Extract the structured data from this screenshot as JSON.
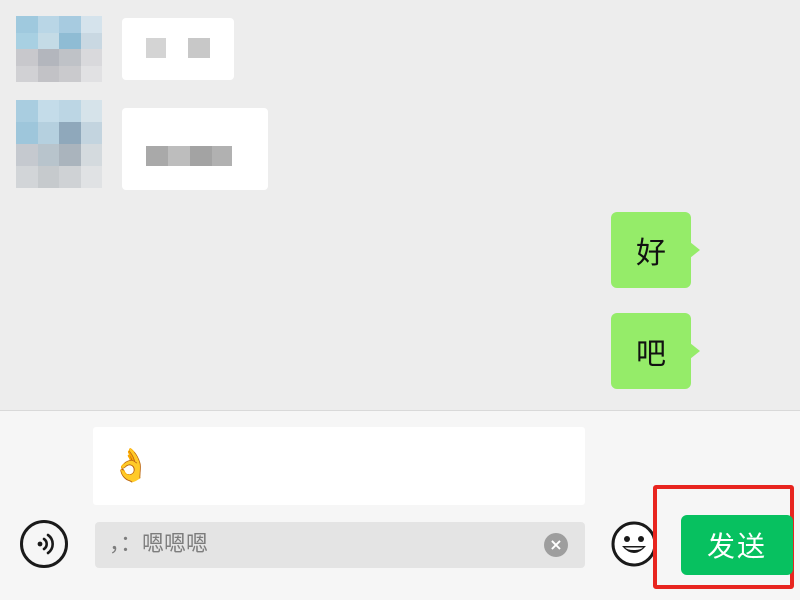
{
  "conversation": {
    "incoming_messages": [
      {
        "sender": "contact",
        "content": "[blurred]"
      },
      {
        "sender": "contact",
        "content": "[blurred]"
      }
    ],
    "outgoing_messages": [
      {
        "text": "好"
      },
      {
        "text": "吧"
      }
    ]
  },
  "composer": {
    "emoji_preview": "👌",
    "input_value": "，：嗯嗯嗯",
    "clear_label": "×",
    "send_label": "发送",
    "voice_icon": "voice-icon",
    "emoji_icon": "smiley-icon"
  },
  "colors": {
    "chat_background": "#ededed",
    "outgoing_bubble": "#95ec69",
    "send_button": "#07c160",
    "highlight_box": "#e8251f"
  }
}
